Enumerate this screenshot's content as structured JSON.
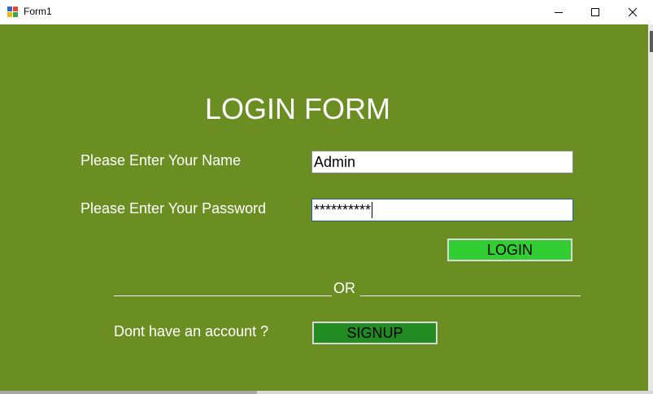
{
  "window": {
    "title": "Form1",
    "icon": "winforms-app-icon",
    "controls": [
      "minimize-icon",
      "maximize-icon",
      "close-icon"
    ]
  },
  "form": {
    "heading": "LOGIN FORM",
    "name_label": "Please Enter Your Name",
    "name_value": "Admin",
    "password_label": "Please Enter Your Password",
    "password_value": "**********",
    "login_button": "LOGIN",
    "divider_text": "OR",
    "account_prompt": "Dont have an account ?",
    "signup_button": "SIGNUP"
  },
  "colors": {
    "background": "#6b8e23",
    "login_button": "#32cd32",
    "signup_button": "#228b22",
    "text": "#ffffff"
  }
}
